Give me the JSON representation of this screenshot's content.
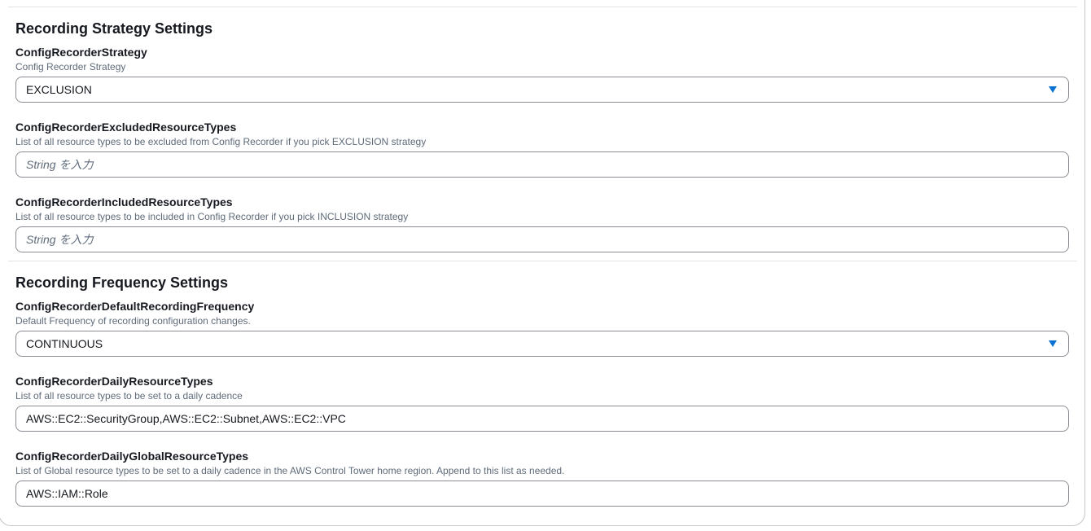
{
  "sections": {
    "strategy": {
      "title": "Recording Strategy Settings",
      "fields": {
        "strategy": {
          "label": "ConfigRecorderStrategy",
          "description": "Config Recorder Strategy",
          "value": "EXCLUSION"
        },
        "excluded": {
          "label": "ConfigRecorderExcludedResourceTypes",
          "description": "List of all resource types to be excluded from Config Recorder if you pick EXCLUSION strategy",
          "value": "",
          "placeholder": "String を入力"
        },
        "included": {
          "label": "ConfigRecorderIncludedResourceTypes",
          "description": "List of all resource types to be included in Config Recorder if you pick INCLUSION strategy",
          "value": "",
          "placeholder": "String を入力"
        }
      }
    },
    "frequency": {
      "title": "Recording Frequency Settings",
      "fields": {
        "default_frequency": {
          "label": "ConfigRecorderDefaultRecordingFrequency",
          "description": "Default Frequency of recording configuration changes.",
          "value": "CONTINUOUS"
        },
        "daily_types": {
          "label": "ConfigRecorderDailyResourceTypes",
          "description": "List of all resource types to be set to a daily cadence",
          "value": "AWS::EC2::SecurityGroup,AWS::EC2::Subnet,AWS::EC2::VPC",
          "placeholder": ""
        },
        "daily_global_types": {
          "label": "ConfigRecorderDailyGlobalResourceTypes",
          "description": "List of Global resource types to be set to a daily cadence in the AWS Control Tower home region. Append to this list as needed.",
          "value": "AWS::IAM::Role",
          "placeholder": ""
        }
      }
    }
  },
  "icons": {
    "select_caret": "caret-down-icon"
  },
  "colors": {
    "accent": "#0972d3",
    "border": "#8c8c94",
    "text": "#16191f",
    "muted": "#5f6b7a"
  }
}
